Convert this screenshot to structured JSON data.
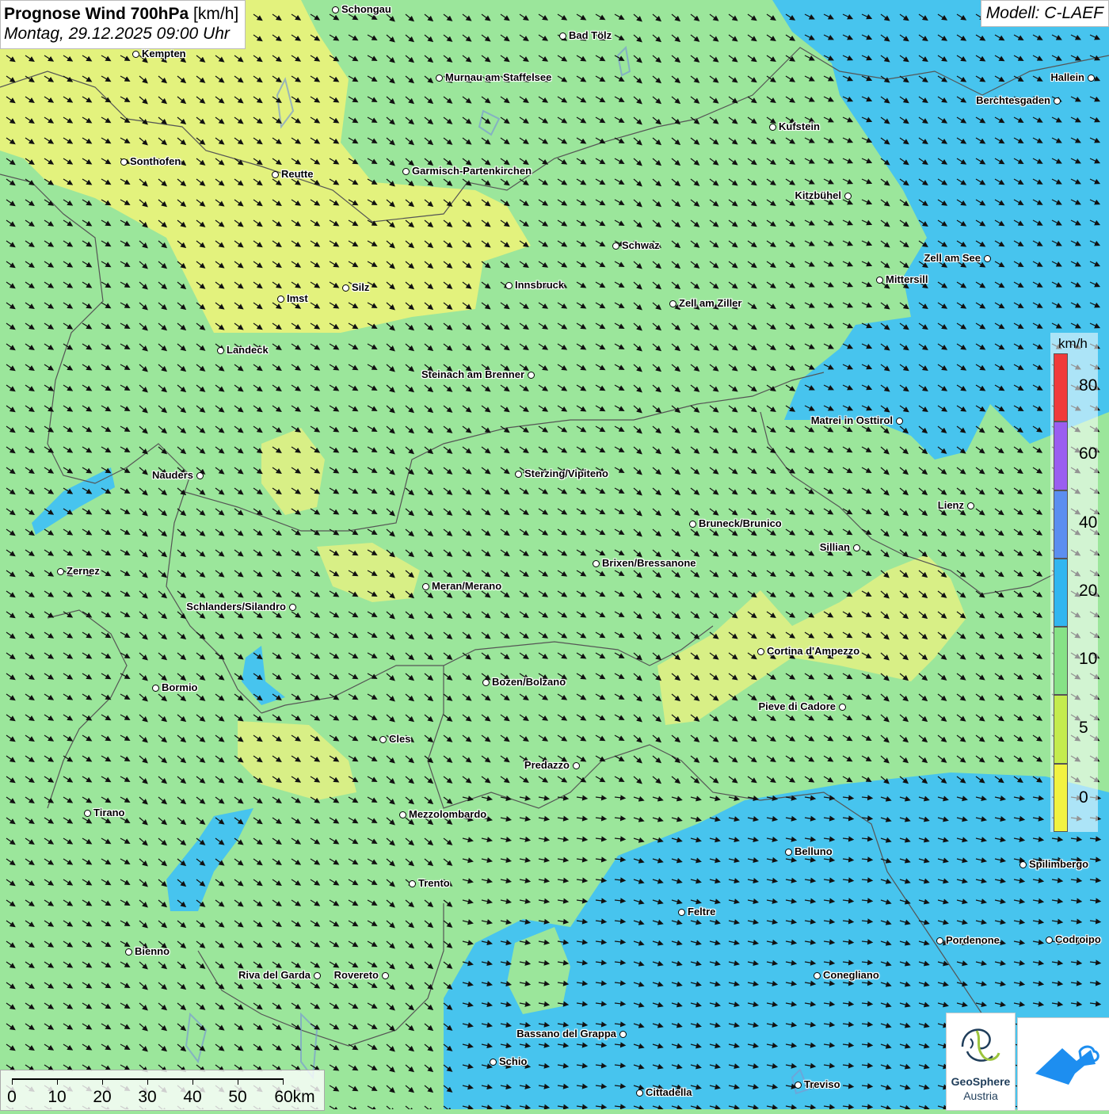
{
  "title": {
    "main": "Prognose Wind 700hPa",
    "unit": "[km/h]",
    "datetime": "Montag, 29.12.2025 09:00 Uhr"
  },
  "model_label": "Modell: C-LAEF",
  "colors": {
    "background_green": "#9be69b",
    "yellow_zone": "#e8f57a",
    "blue_zone": "#47c4ee",
    "arrow": "#111111",
    "border": "#555555"
  },
  "legend": {
    "unit": "km/h",
    "classes": [
      {
        "from": 0,
        "to": 5,
        "color": "#f2f241"
      },
      {
        "from": 5,
        "to": 10,
        "color": "#c4ec4e"
      },
      {
        "from": 10,
        "to": 20,
        "color": "#86e286"
      },
      {
        "from": 20,
        "to": 40,
        "color": "#31b6f0"
      },
      {
        "from": 40,
        "to": 60,
        "color": "#5b8ef0"
      },
      {
        "from": 60,
        "to": 80,
        "color": "#9a5ef0"
      },
      {
        "from": 80,
        "to": 100,
        "color": "#f03a3a"
      }
    ],
    "labels": [
      "0",
      "5",
      "10",
      "20",
      "40",
      "60",
      "80"
    ]
  },
  "scalebar": {
    "labels": [
      "0",
      "10",
      "20",
      "30",
      "40",
      "50",
      "60km"
    ]
  },
  "logos": {
    "geosphere_name": "GeoSphere",
    "geosphere_sub": "Austria",
    "app_icon": "wetter-app-icon"
  },
  "cities": [
    {
      "name": "Schongau"
    },
    {
      "name": "Bad Tölz"
    },
    {
      "name": "Kempten"
    },
    {
      "name": "Murnau am Staffelsee"
    },
    {
      "name": "Hallein"
    },
    {
      "name": "Berchtesgaden"
    },
    {
      "name": "Kufstein"
    },
    {
      "name": "Sonthofen"
    },
    {
      "name": "Reutte"
    },
    {
      "name": "Garmisch-Partenkirchen"
    },
    {
      "name": "Kitzbühel"
    },
    {
      "name": "Schwaz"
    },
    {
      "name": "Zell am See"
    },
    {
      "name": "Mittersill"
    },
    {
      "name": "Innsbruck"
    },
    {
      "name": "Imst"
    },
    {
      "name": "Silz"
    },
    {
      "name": "Zell am Ziller"
    },
    {
      "name": "Landeck"
    },
    {
      "name": "Steinach am Brenner"
    },
    {
      "name": "Matrei in Osttirol"
    },
    {
      "name": "Nauders"
    },
    {
      "name": "Sterzing/Vipiteno"
    },
    {
      "name": "Lienz"
    },
    {
      "name": "Bruneck/Brunico"
    },
    {
      "name": "Sillian"
    },
    {
      "name": "Zernez"
    },
    {
      "name": "Brixen/Bressanone"
    },
    {
      "name": "Meran/Merano"
    },
    {
      "name": "Schlanders/Silandro"
    },
    {
      "name": "Cortina d'Ampezzo"
    },
    {
      "name": "Bormio"
    },
    {
      "name": "Bozen/Bolzano"
    },
    {
      "name": "Pieve di Cadore"
    },
    {
      "name": "Cles"
    },
    {
      "name": "Predazzo"
    },
    {
      "name": "Tirano"
    },
    {
      "name": "Mezzolombardo"
    },
    {
      "name": "Belluno"
    },
    {
      "name": "Spilimbergo"
    },
    {
      "name": "Trento"
    },
    {
      "name": "Feltre"
    },
    {
      "name": "Bienno"
    },
    {
      "name": "Pordenone"
    },
    {
      "name": "Codroipo"
    },
    {
      "name": "Riva del Garda"
    },
    {
      "name": "Rovereto"
    },
    {
      "name": "Conegliano"
    },
    {
      "name": "Bassano del Grappa"
    },
    {
      "name": "Schio"
    },
    {
      "name": "Treviso"
    },
    {
      "name": "Cittadella"
    }
  ]
}
